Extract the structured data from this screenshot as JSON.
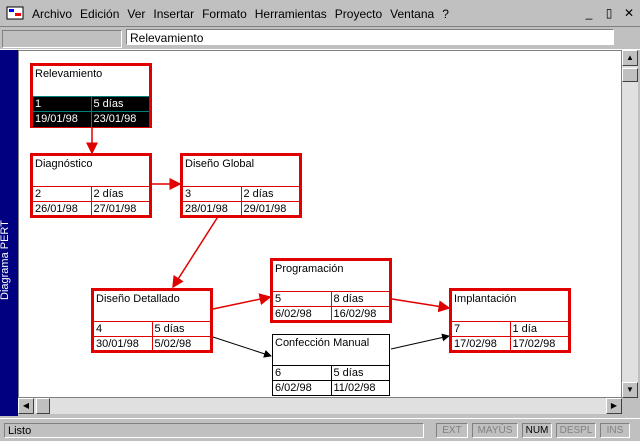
{
  "menu": {
    "items": [
      "Archivo",
      "Edición",
      "Ver",
      "Insertar",
      "Formato",
      "Herramientas",
      "Proyecto",
      "Ventana",
      "?"
    ],
    "win_buttons": [
      "_",
      "▯",
      "✕"
    ]
  },
  "formula": {
    "value": "Relevamiento"
  },
  "sidebar": {
    "label": "Diagrama PERT"
  },
  "nodes": [
    {
      "name": "Relevamiento",
      "id": "1",
      "duration": "5 días",
      "start": "19/01/98",
      "finish": "23/01/98"
    },
    {
      "name": "Diagnóstico",
      "id": "2",
      "duration": "2 días",
      "start": "26/01/98",
      "finish": "27/01/98"
    },
    {
      "name": "Diseño Global",
      "id": "3",
      "duration": "2 días",
      "start": "28/01/98",
      "finish": "29/01/98"
    },
    {
      "name": "Diseño Detallado",
      "id": "4",
      "duration": "5 días",
      "start": "30/01/98",
      "finish": "5/02/98"
    },
    {
      "name": "Programación",
      "id": "5",
      "duration": "8 días",
      "start": "6/02/98",
      "finish": "16/02/98"
    },
    {
      "name": "Confección Manual",
      "id": "6",
      "duration": "5 días",
      "start": "6/02/98",
      "finish": "11/02/98"
    },
    {
      "name": "Implantación",
      "id": "7",
      "duration": "1 día",
      "start": "17/02/98",
      "finish": "17/02/98"
    }
  ],
  "status": {
    "text": "Listo",
    "indicators": [
      "EXT",
      "MAYÚS",
      "NUM",
      "DESPL",
      "INS"
    ]
  },
  "colors": {
    "critical": "#e00000",
    "normal": "#000000",
    "sidebar": "#000080"
  }
}
